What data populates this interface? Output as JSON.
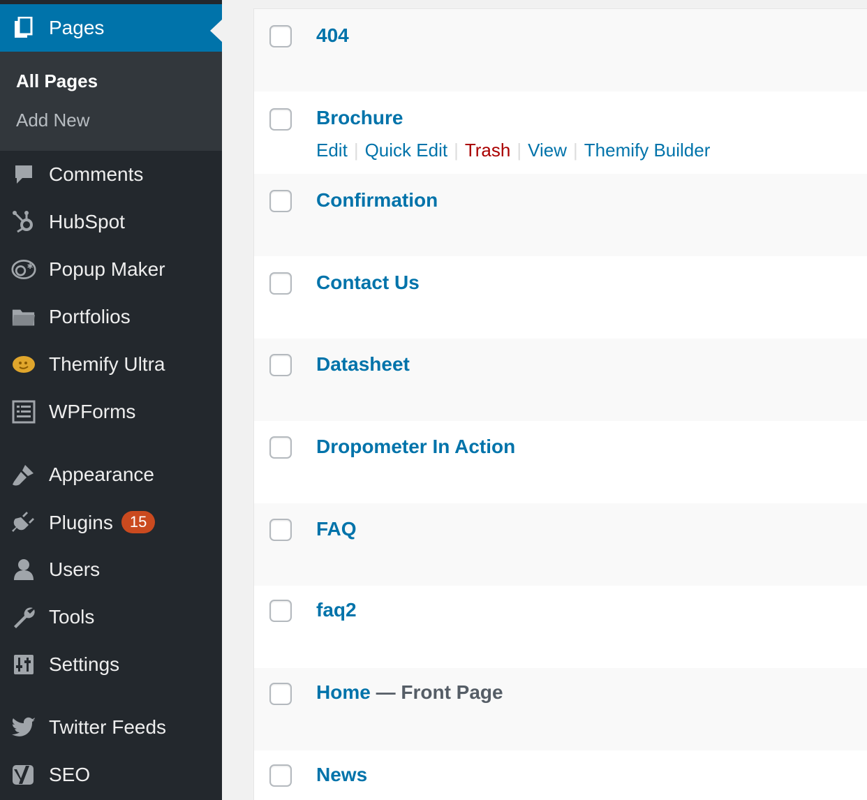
{
  "sidebar": {
    "current": {
      "label": "Pages",
      "icon": "pages-icon"
    },
    "submenu": [
      {
        "label": "All Pages",
        "current": true
      },
      {
        "label": "Add New",
        "current": false
      }
    ],
    "items": [
      {
        "label": "Comments",
        "icon": "comments-icon"
      },
      {
        "label": "HubSpot",
        "icon": "hubspot-icon"
      },
      {
        "label": "Popup Maker",
        "icon": "popup-maker-icon"
      },
      {
        "label": "Portfolios",
        "icon": "folder-icon"
      },
      {
        "label": "Themify Ultra",
        "icon": "themify-icon"
      },
      {
        "label": "WPForms",
        "icon": "form-icon"
      },
      {
        "label": "Appearance",
        "icon": "brush-icon"
      },
      {
        "label": "Plugins",
        "icon": "plugin-icon",
        "badge": "15"
      },
      {
        "label": "Users",
        "icon": "user-icon"
      },
      {
        "label": "Tools",
        "icon": "wrench-icon"
      },
      {
        "label": "Settings",
        "icon": "settings-icon"
      },
      {
        "label": "Twitter Feeds",
        "icon": "twitter-icon"
      },
      {
        "label": "SEO",
        "icon": "yoast-icon"
      }
    ],
    "colors": {
      "bg": "#23282d",
      "active": "#0073aa",
      "submenu_bg": "#32373c",
      "badge": "#ca4a1f"
    }
  },
  "pages": {
    "rows": [
      {
        "title": "404"
      },
      {
        "title": "Brochure",
        "actions": [
          "Edit",
          "Quick Edit",
          "Trash",
          "View",
          "Themify Builder"
        ]
      },
      {
        "title": "Confirmation"
      },
      {
        "title": "Contact Us"
      },
      {
        "title": "Datasheet"
      },
      {
        "title": "Dropometer In Action"
      },
      {
        "title": "FAQ"
      },
      {
        "title": "faq2"
      },
      {
        "title": "Home",
        "state": " — Front Page"
      },
      {
        "title": "News"
      }
    ],
    "colors": {
      "link": "#0073aa",
      "trash": "#aa0000"
    }
  }
}
